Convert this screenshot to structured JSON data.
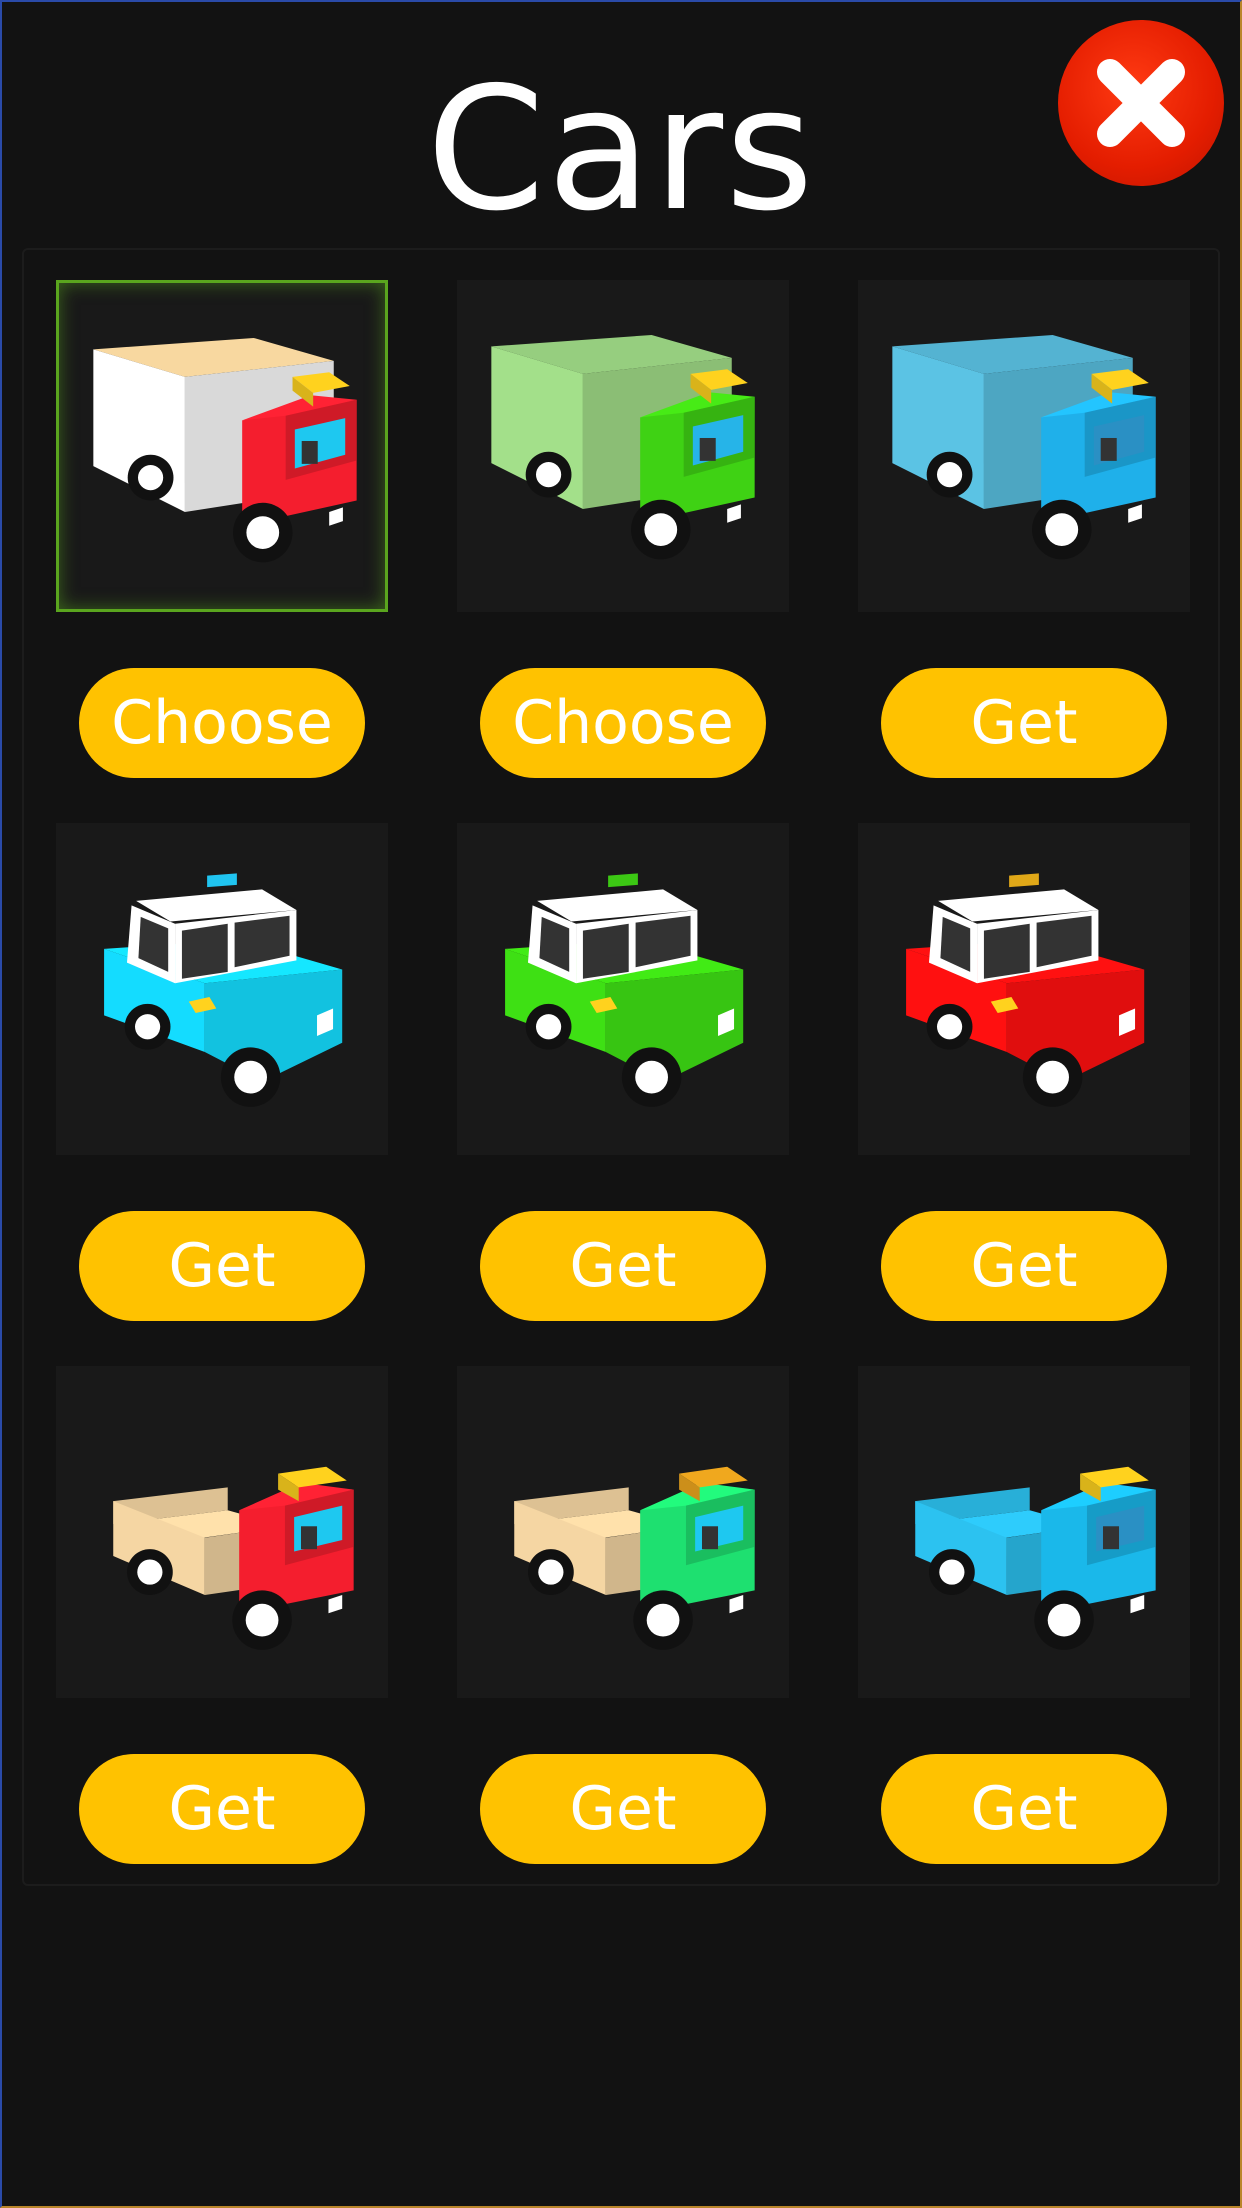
{
  "header": {
    "title": "Cars"
  },
  "close": {
    "icon": "close-icon"
  },
  "colors": {
    "button": "#ffc200",
    "close": "#e41d00",
    "selected_border": "#5aa51e",
    "background": "#121212"
  },
  "cars": [
    {
      "kind": "truck",
      "body": "#f41e2e",
      "box": "#ffffff",
      "accent": "#1ec8f0",
      "lights": "#ffd21e",
      "selected": true,
      "button": "Choose"
    },
    {
      "kind": "truck",
      "body": "#3fd214",
      "box": "#a3e08a",
      "accent": "#26b4e8",
      "lights": "#ffd21e",
      "selected": false,
      "button": "Choose"
    },
    {
      "kind": "truck",
      "body": "#1fb0ea",
      "box": "#5bc3e4",
      "accent": "#2a90c4",
      "lights": "#ffd21e",
      "selected": false,
      "button": "Get"
    },
    {
      "kind": "taxi",
      "body": "#14dcff",
      "roof": "#ffffff",
      "sign": "#20c4f0",
      "selected": false,
      "button": "Get"
    },
    {
      "kind": "taxi",
      "body": "#3ee014",
      "roof": "#ffffff",
      "sign": "#3cc814",
      "selected": false,
      "button": "Get"
    },
    {
      "kind": "taxi",
      "body": "#ff1010",
      "roof": "#ffffff",
      "sign": "#e0a818",
      "selected": false,
      "button": "Get"
    },
    {
      "kind": "pickup",
      "body": "#f41e2e",
      "bed": "#f5d6a3",
      "accent": "#1ec8f0",
      "lights": "#ffd21e",
      "selected": false,
      "button": "Get"
    },
    {
      "kind": "pickup",
      "body": "#1ee070",
      "bed": "#f5d6a3",
      "accent": "#1ec8f0",
      "lights": "#f0a81e",
      "selected": false,
      "button": "Get"
    },
    {
      "kind": "pickup",
      "body": "#1ab8ea",
      "bed": "#2cc2f0",
      "accent": "#2a90c4",
      "lights": "#ffd21e",
      "selected": false,
      "button": "Get"
    }
  ]
}
